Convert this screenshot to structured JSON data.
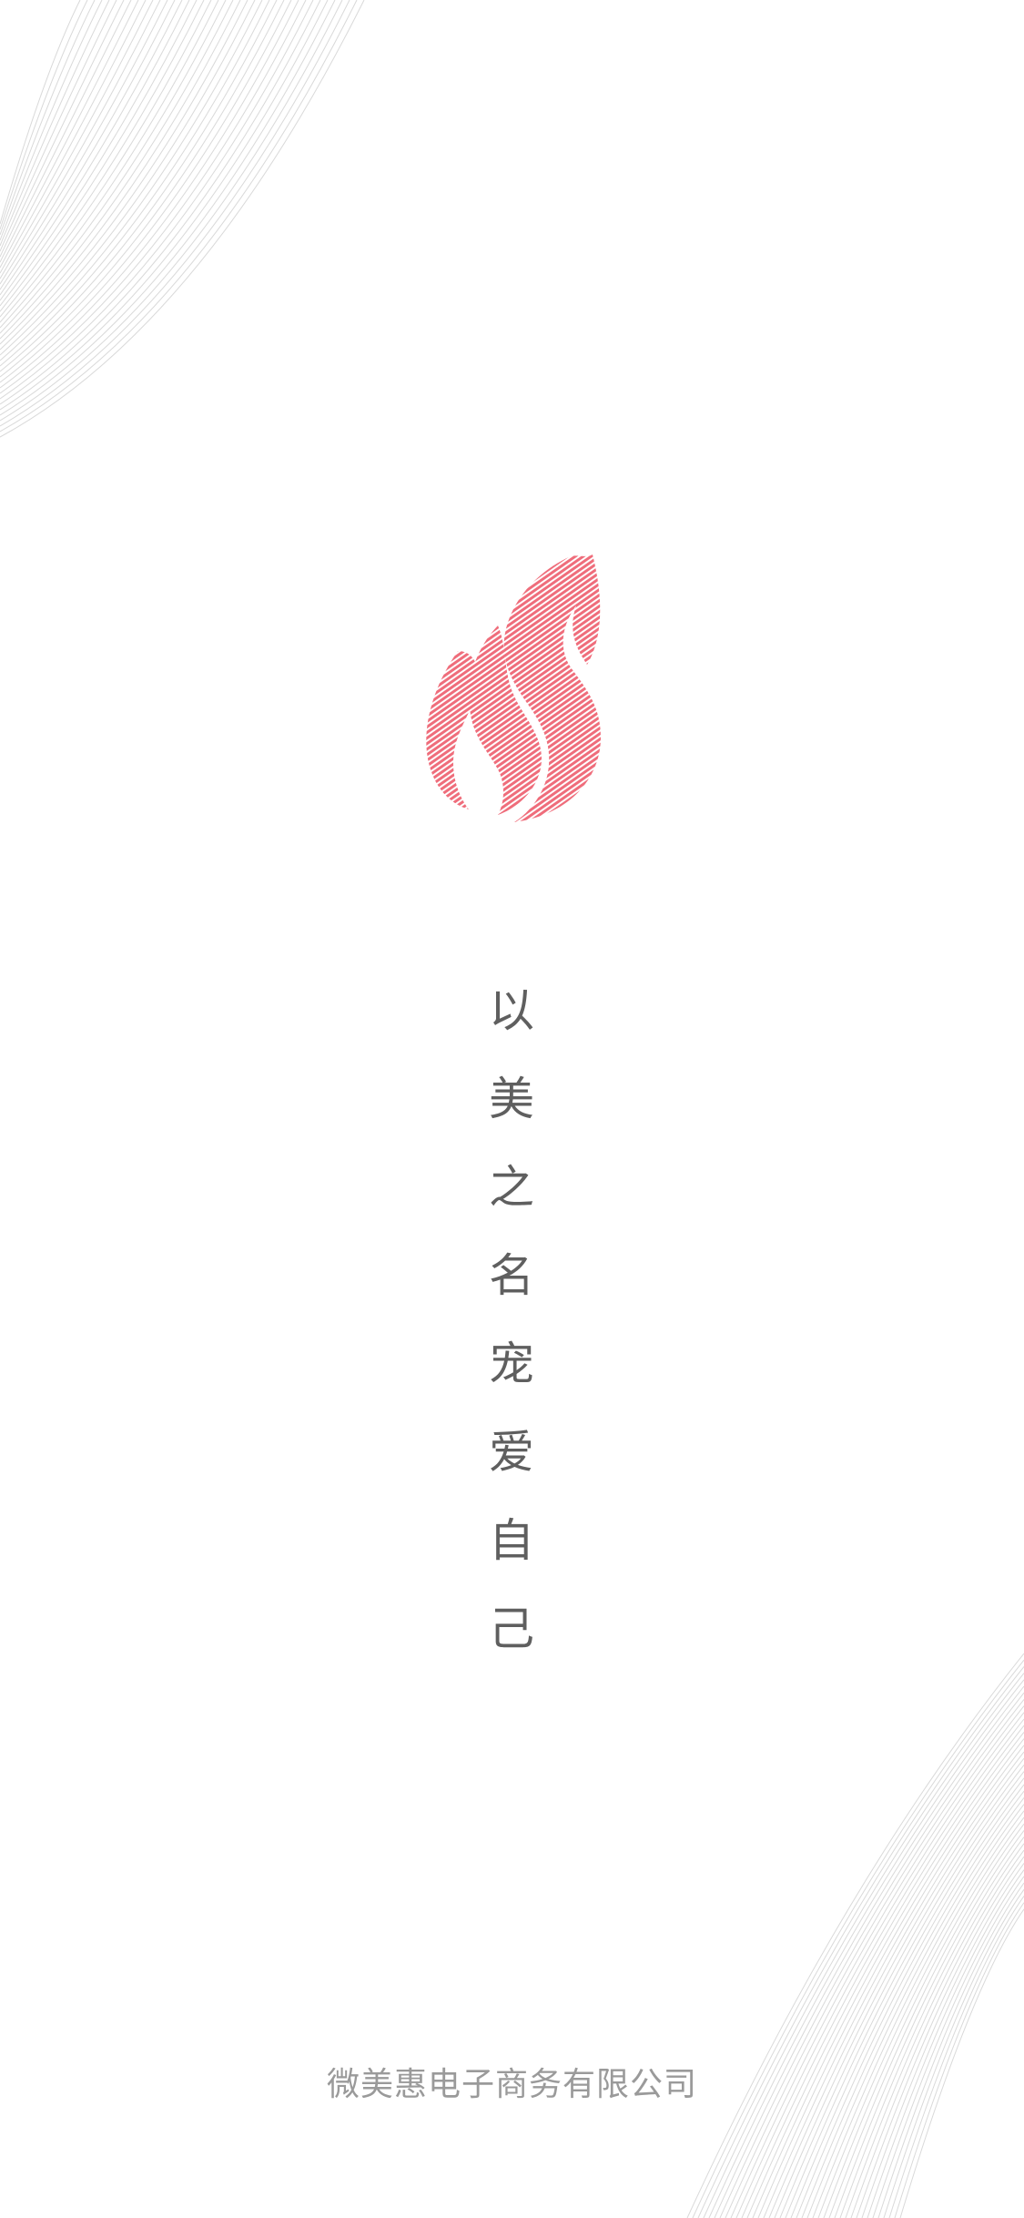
{
  "splash": {
    "slogan_chars": [
      "以",
      "美",
      "之",
      "名",
      "宠",
      "爱",
      "自",
      "己"
    ],
    "company": "微美惠电子商务有限公司"
  },
  "colors": {
    "brand": "#EF6D7B",
    "text": "#5f5f5f",
    "muted": "#9a9a9a",
    "deco_lines": "#d6d6d6"
  },
  "icons": {
    "logo": "flame-logo-icon"
  }
}
